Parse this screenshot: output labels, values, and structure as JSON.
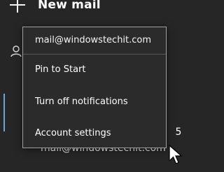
{
  "header": {
    "new_mail_label": "New mail"
  },
  "context_menu": {
    "account_email": "mail@windowstechit.com",
    "items": [
      {
        "label": "Pin to Start"
      },
      {
        "label": "Turn off notifications"
      },
      {
        "label": "Account settings"
      }
    ]
  },
  "account_list": {
    "count": "5",
    "email": "mail@windowstechit.com"
  },
  "colors": {
    "background": "#262626",
    "menu_background": "#2b2b2b",
    "menu_border": "#a0a0a0",
    "accent": "#6aa8d9",
    "text": "#ffffff"
  },
  "icons": {
    "new_mail": "plus-icon",
    "account": "person-icon",
    "pointer": "cursor-icon"
  }
}
